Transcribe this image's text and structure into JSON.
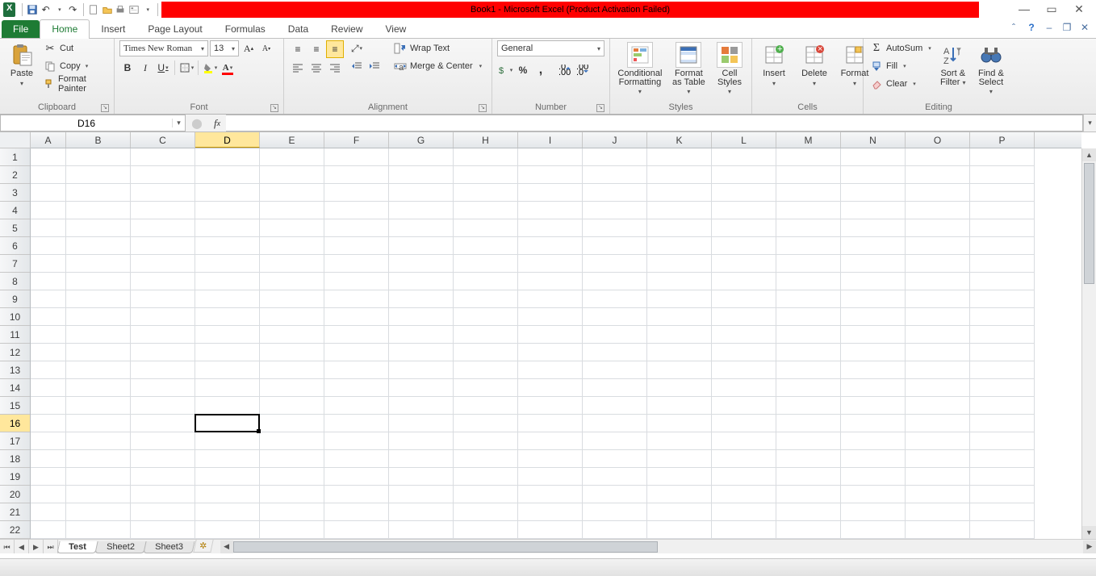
{
  "title": "Book1 - Microsoft Excel (Product Activation Failed)",
  "qat": {
    "save": "save-icon",
    "undo": "undo-icon",
    "redo": "redo-icon",
    "extras": [
      "new",
      "open",
      "quickprint",
      "preview",
      "more"
    ]
  },
  "tabs": {
    "file": "File",
    "items": [
      "Home",
      "Insert",
      "Page Layout",
      "Formulas",
      "Data",
      "Review",
      "View"
    ],
    "active": 0
  },
  "ribbon": {
    "clipboard": {
      "label": "Clipboard",
      "paste": "Paste",
      "cut": "Cut",
      "copy": "Copy",
      "format_painter": "Format Painter"
    },
    "font": {
      "label": "Font",
      "font_name": "Times New Roman",
      "font_size": "13",
      "bold": "B",
      "italic": "I",
      "underline": "U"
    },
    "alignment": {
      "label": "Alignment",
      "wrap": "Wrap Text",
      "merge": "Merge & Center"
    },
    "number": {
      "label": "Number",
      "format": "General"
    },
    "styles": {
      "label": "Styles",
      "cond": "Conditional",
      "cond2": "Formatting",
      "table": "Format",
      "table2": "as Table",
      "cell": "Cell",
      "cell2": "Styles"
    },
    "cells": {
      "label": "Cells",
      "insert": "Insert",
      "delete": "Delete",
      "format": "Format"
    },
    "editing": {
      "label": "Editing",
      "autosum": "AutoSum",
      "fill": "Fill",
      "clear": "Clear",
      "sort": "Sort &",
      "sort2": "Filter",
      "find": "Find &",
      "find2": "Select"
    }
  },
  "name_box": "D16",
  "formula": "",
  "columns": [
    "A",
    "B",
    "C",
    "D",
    "E",
    "F",
    "G",
    "H",
    "I",
    "J",
    "K",
    "L",
    "M",
    "N",
    "O",
    "P"
  ],
  "active_col_index": 3,
  "rows": 23,
  "active_row": 16,
  "selection": {
    "col": 3,
    "row": 16
  },
  "sheets": {
    "items": [
      "Test",
      "Sheet2",
      "Sheet3"
    ],
    "active": 0
  },
  "status": " "
}
